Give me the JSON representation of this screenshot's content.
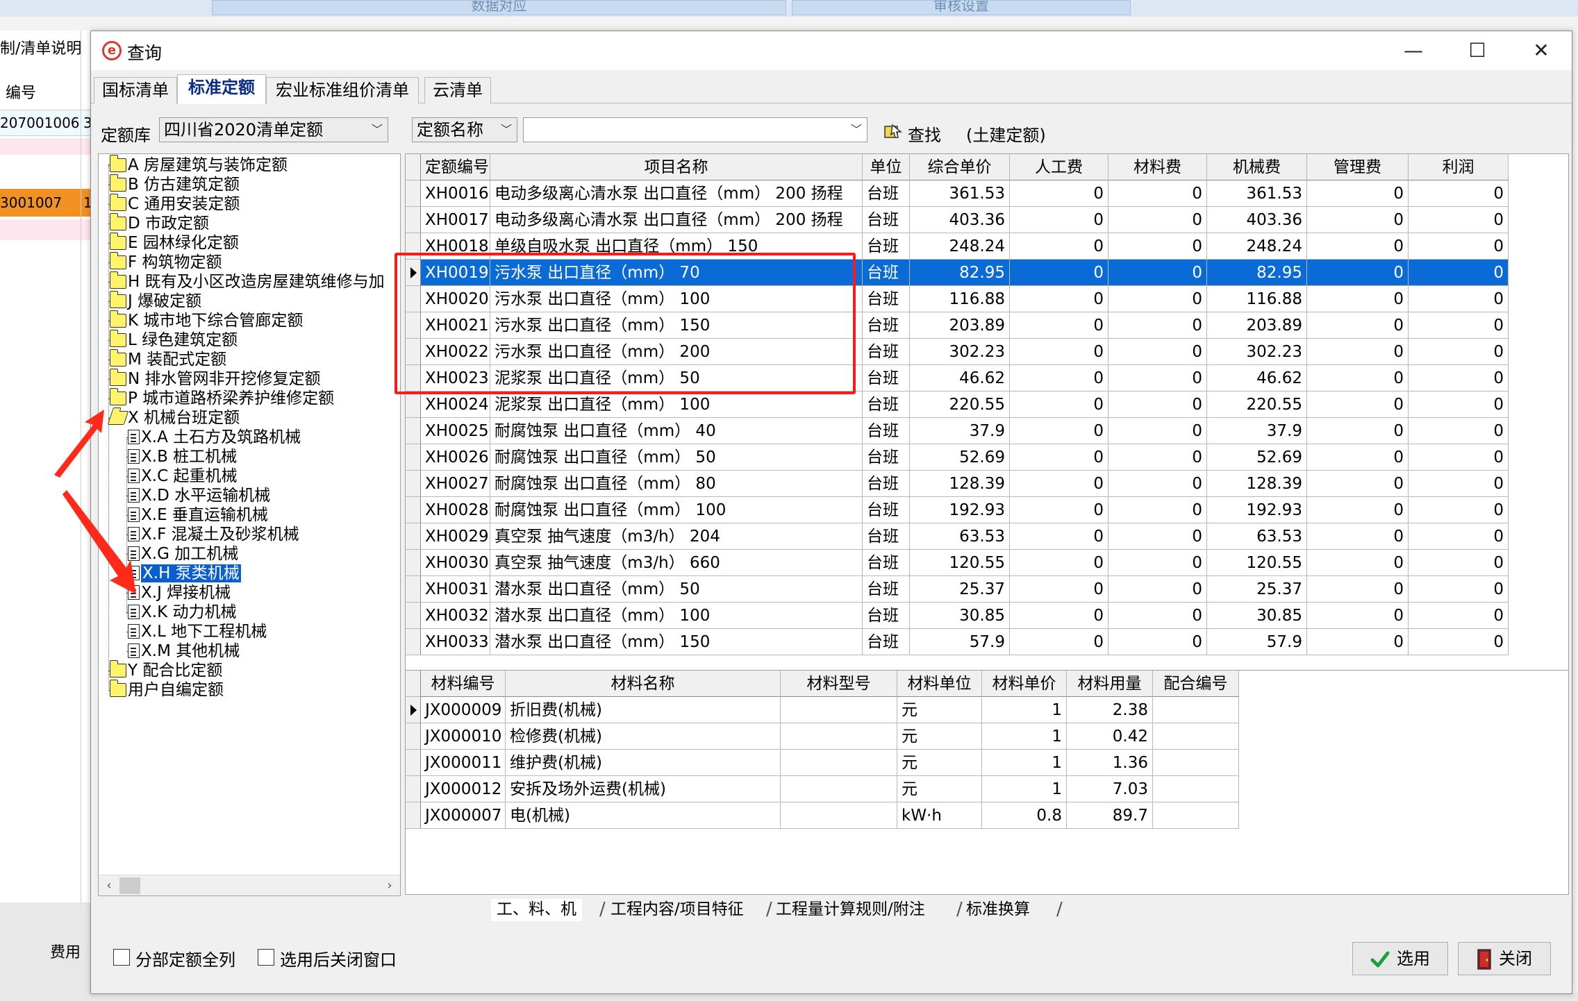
{
  "background": {
    "top_tabs": [
      "数据对应",
      "审核设置"
    ],
    "left_labels": [
      "制/清单说明",
      "编号",
      "207001006",
      "3",
      "3001007",
      "1",
      "费用"
    ]
  },
  "dialog": {
    "title": "查询",
    "window_controls": {
      "minimize": "—",
      "maximize": "☐",
      "close": "✕"
    },
    "tabs": [
      "国标清单",
      "标准定额",
      "宏业标准组价清单",
      "云清单"
    ],
    "active_tab": "标准定额",
    "toolbar": {
      "library_label": "定额库",
      "library_value": "四川省2020清单定额",
      "field_value": "定额名称",
      "search_value": "",
      "find_label": "查找",
      "scope_label": "(土建定额)"
    },
    "tree": {
      "nodes": [
        {
          "label": "A 房屋建筑与装饰定额",
          "type": "folder",
          "level": 0
        },
        {
          "label": "B 仿古建筑定额",
          "type": "folder",
          "level": 0
        },
        {
          "label": "C 通用安装定额",
          "type": "folder",
          "level": 0
        },
        {
          "label": "D 市政定额",
          "type": "folder",
          "level": 0
        },
        {
          "label": "E 园林绿化定额",
          "type": "folder",
          "level": 0
        },
        {
          "label": "F 构筑物定额",
          "type": "folder",
          "level": 0
        },
        {
          "label": "H 既有及小区改造房屋建筑维修与加",
          "type": "folder",
          "level": 0
        },
        {
          "label": "J 爆破定额",
          "type": "folder",
          "level": 0
        },
        {
          "label": "K 城市地下综合管廊定额",
          "type": "folder",
          "level": 0
        },
        {
          "label": "L 绿色建筑定额",
          "type": "folder",
          "level": 0
        },
        {
          "label": "M 装配式定额",
          "type": "folder",
          "level": 0
        },
        {
          "label": "N 排水管网非开挖修复定额",
          "type": "folder",
          "level": 0
        },
        {
          "label": "P 城市道路桥梁养护维修定额",
          "type": "folder",
          "level": 0
        },
        {
          "label": "X 机械台班定额",
          "type": "folder-open",
          "level": 0
        },
        {
          "label": "X.A 土石方及筑路机械",
          "type": "doc",
          "level": 1
        },
        {
          "label": "X.B 桩工机械",
          "type": "doc",
          "level": 1
        },
        {
          "label": "X.C 起重机械",
          "type": "doc",
          "level": 1
        },
        {
          "label": "X.D 水平运输机械",
          "type": "doc",
          "level": 1
        },
        {
          "label": "X.E 垂直运输机械",
          "type": "doc",
          "level": 1
        },
        {
          "label": "X.F 混凝土及砂浆机械",
          "type": "doc",
          "level": 1
        },
        {
          "label": "X.G 加工机械",
          "type": "doc",
          "level": 1
        },
        {
          "label": "X.H 泵类机械",
          "type": "doc",
          "level": 1,
          "selected": true
        },
        {
          "label": "X.J 焊接机械",
          "type": "doc",
          "level": 1
        },
        {
          "label": "X.K 动力机械",
          "type": "doc",
          "level": 1
        },
        {
          "label": "X.L 地下工程机械",
          "type": "doc",
          "level": 1
        },
        {
          "label": "X.M 其他机械",
          "type": "doc",
          "level": 1
        },
        {
          "label": "Y 配合比定额",
          "type": "folder",
          "level": 0
        },
        {
          "label": "用户自编定额",
          "type": "folder",
          "level": 0
        }
      ]
    },
    "quota_table": {
      "headers": [
        "定额编号",
        "项目名称",
        "单位",
        "综合单价",
        "人工费",
        "材料费",
        "机械费",
        "管理费",
        "利润"
      ],
      "selected_row": 3,
      "rows": [
        [
          "XH0016",
          "电动多级离心清水泵 出口直径（mm） 200 扬程",
          "台班",
          "361.53",
          "0",
          "0",
          "361.53",
          "0",
          "0"
        ],
        [
          "XH0017",
          "电动多级离心清水泵 出口直径（mm） 200 扬程",
          "台班",
          "403.36",
          "0",
          "0",
          "403.36",
          "0",
          "0"
        ],
        [
          "XH0018",
          "单级自吸水泵 出口直径（mm） 150",
          "台班",
          "248.24",
          "0",
          "0",
          "248.24",
          "0",
          "0"
        ],
        [
          "XH0019",
          "污水泵 出口直径（mm） 70",
          "台班",
          "82.95",
          "0",
          "0",
          "82.95",
          "0",
          "0"
        ],
        [
          "XH0020",
          "污水泵 出口直径（mm） 100",
          "台班",
          "116.88",
          "0",
          "0",
          "116.88",
          "0",
          "0"
        ],
        [
          "XH0021",
          "污水泵 出口直径（mm） 150",
          "台班",
          "203.89",
          "0",
          "0",
          "203.89",
          "0",
          "0"
        ],
        [
          "XH0022",
          "污水泵 出口直径（mm） 200",
          "台班",
          "302.23",
          "0",
          "0",
          "302.23",
          "0",
          "0"
        ],
        [
          "XH0023",
          "泥浆泵 出口直径（mm） 50",
          "台班",
          "46.62",
          "0",
          "0",
          "46.62",
          "0",
          "0"
        ],
        [
          "XH0024",
          "泥浆泵 出口直径（mm） 100",
          "台班",
          "220.55",
          "0",
          "0",
          "220.55",
          "0",
          "0"
        ],
        [
          "XH0025",
          "耐腐蚀泵 出口直径（mm） 40",
          "台班",
          "37.9",
          "0",
          "0",
          "37.9",
          "0",
          "0"
        ],
        [
          "XH0026",
          "耐腐蚀泵 出口直径（mm） 50",
          "台班",
          "52.69",
          "0",
          "0",
          "52.69",
          "0",
          "0"
        ],
        [
          "XH0027",
          "耐腐蚀泵 出口直径（mm） 80",
          "台班",
          "128.39",
          "0",
          "0",
          "128.39",
          "0",
          "0"
        ],
        [
          "XH0028",
          "耐腐蚀泵 出口直径（mm） 100",
          "台班",
          "192.93",
          "0",
          "0",
          "192.93",
          "0",
          "0"
        ],
        [
          "XH0029",
          "真空泵 抽气速度（m3/h） 204",
          "台班",
          "63.53",
          "0",
          "0",
          "63.53",
          "0",
          "0"
        ],
        [
          "XH0030",
          "真空泵 抽气速度（m3/h） 660",
          "台班",
          "120.55",
          "0",
          "0",
          "120.55",
          "0",
          "0"
        ],
        [
          "XH0031",
          "潜水泵 出口直径（mm） 50",
          "台班",
          "25.37",
          "0",
          "0",
          "25.37",
          "0",
          "0"
        ],
        [
          "XH0032",
          "潜水泵 出口直径（mm） 100",
          "台班",
          "30.85",
          "0",
          "0",
          "30.85",
          "0",
          "0"
        ],
        [
          "XH0033",
          "潜水泵 出口直径（mm） 150",
          "台班",
          "57.9",
          "0",
          "0",
          "57.9",
          "0",
          "0"
        ]
      ]
    },
    "material_table": {
      "headers": [
        "材料编号",
        "材料名称",
        "材料型号",
        "材料单位",
        "材料单价",
        "材料用量",
        "配合编号"
      ],
      "rows": [
        [
          "JX000009",
          "折旧费(机械)",
          "",
          "元",
          "1",
          "2.38",
          ""
        ],
        [
          "JX000010",
          "检修费(机械)",
          "",
          "元",
          "1",
          "0.42",
          ""
        ],
        [
          "JX000011",
          "维护费(机械)",
          "",
          "元",
          "1",
          "1.36",
          ""
        ],
        [
          "JX000012",
          "安拆及场外运费(机械)",
          "",
          "元",
          "1",
          "7.03",
          ""
        ],
        [
          "JX000007",
          "电(机械)",
          "",
          "kW·h",
          "0.8",
          "89.7",
          ""
        ]
      ]
    },
    "bottom_tabs": [
      "工、料、机",
      "工程内容/项目特征",
      "工程量计算规则/附注",
      "标准换算"
    ],
    "footer": {
      "checkbox1": "分部定额全列",
      "checkbox2": "选用后关闭窗口",
      "select_button": "选用",
      "close_button": "关闭"
    },
    "accent_colors": {
      "selection": "#0a6bd6",
      "annotation": "#ff1a1a"
    }
  }
}
